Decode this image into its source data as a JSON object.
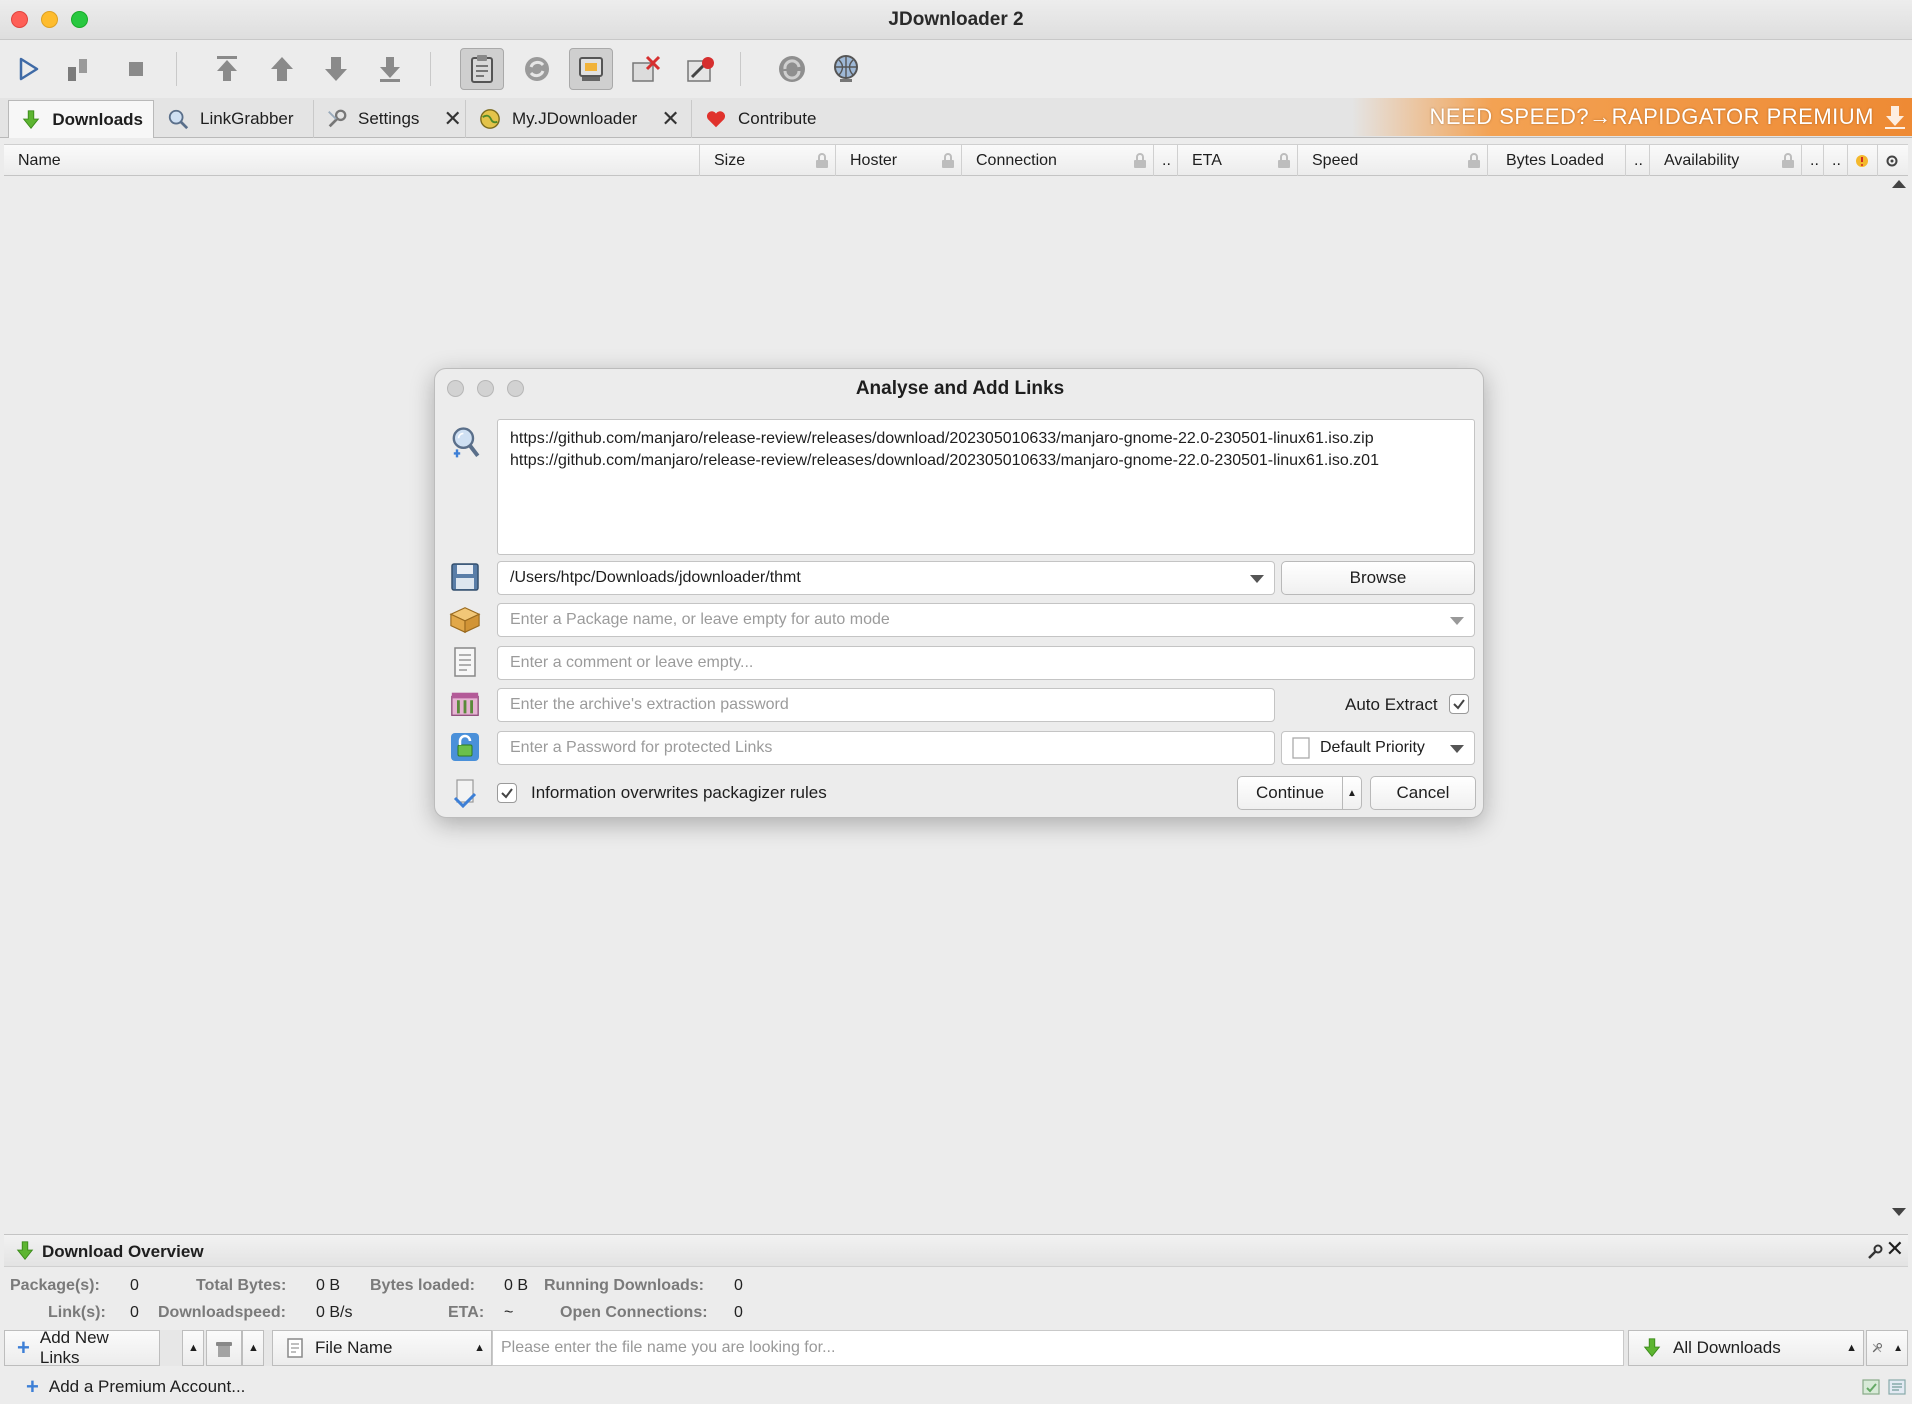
{
  "window": {
    "title": "JDownloader 2"
  },
  "toolbar": {
    "buttons": [
      "start-downloads",
      "pause-downloads",
      "stop-downloads",
      "move-to-top",
      "move-up",
      "move-down",
      "move-to-bottom",
      "clipboard-observer",
      "reconnect",
      "premium-toggle",
      "clear-finished",
      "disable-silent",
      "update",
      "reconnect-globe"
    ]
  },
  "tabs": [
    {
      "label": "Downloads",
      "icon": "download-arrow-icon"
    },
    {
      "label": "LinkGrabber",
      "icon": "magnifier-icon"
    },
    {
      "label": "Settings",
      "icon": "wrench-icon",
      "closable": true
    },
    {
      "label": "My.JDownloader",
      "icon": "globe-icon",
      "closable": true
    },
    {
      "label": "Contribute",
      "icon": "heart-icon"
    }
  ],
  "promo": {
    "text": "NEED SPEED?→RAPIDGATOR PREMIUM",
    "color": "#ee8a34"
  },
  "table": {
    "columns": [
      "Name",
      "Size",
      "Hoster",
      "Connection",
      "..",
      "ETA",
      "Speed",
      "Bytes Loaded",
      "..",
      "Availability",
      "..",
      ".."
    ]
  },
  "dialog": {
    "title": "Analyse and Add Links",
    "links": [
      "https://github.com/manjaro/release-review/releases/download/202305010633/manjaro-gnome-22.0-230501-linux61.iso.zip",
      "https://github.com/manjaro/release-review/releases/download/202305010633/manjaro-gnome-22.0-230501-linux61.iso.z01"
    ],
    "save_path": "/Users/htpc/Downloads/jdownloader/thmt",
    "browse_label": "Browse",
    "package_placeholder": "Enter a Package name, or leave empty for auto mode",
    "comment_placeholder": "Enter a comment or leave empty...",
    "archive_password_placeholder": "Enter the archive's extraction password",
    "auto_extract_label": "Auto Extract",
    "auto_extract_checked": true,
    "link_password_placeholder": "Enter a Password for protected Links",
    "priority": "Default Priority",
    "overwrite_label": "Information overwrites packagizer rules",
    "overwrite_checked": true,
    "continue_label": "Continue",
    "cancel_label": "Cancel"
  },
  "overview": {
    "title": "Download Overview",
    "packages_label": "Package(s):",
    "packages": "0",
    "total_bytes_label": "Total Bytes:",
    "total_bytes": "0 B",
    "bytes_loaded_label": "Bytes loaded:",
    "bytes_loaded": "0 B",
    "running_label": "Running Downloads:",
    "running": "0",
    "links_label": "Link(s):",
    "links": "0",
    "speed_label": "Downloadspeed:",
    "speed": "0 B/s",
    "eta_label": "ETA:",
    "eta": "~",
    "connections_label": "Open Connections:",
    "connections": "0"
  },
  "bottombar": {
    "add_links": "Add New Links",
    "search_field": "File Name",
    "search_placeholder": "Please enter the file name you are looking for...",
    "filter": "All Downloads"
  },
  "statusbar": {
    "add_premium": "Add a Premium Account..."
  }
}
